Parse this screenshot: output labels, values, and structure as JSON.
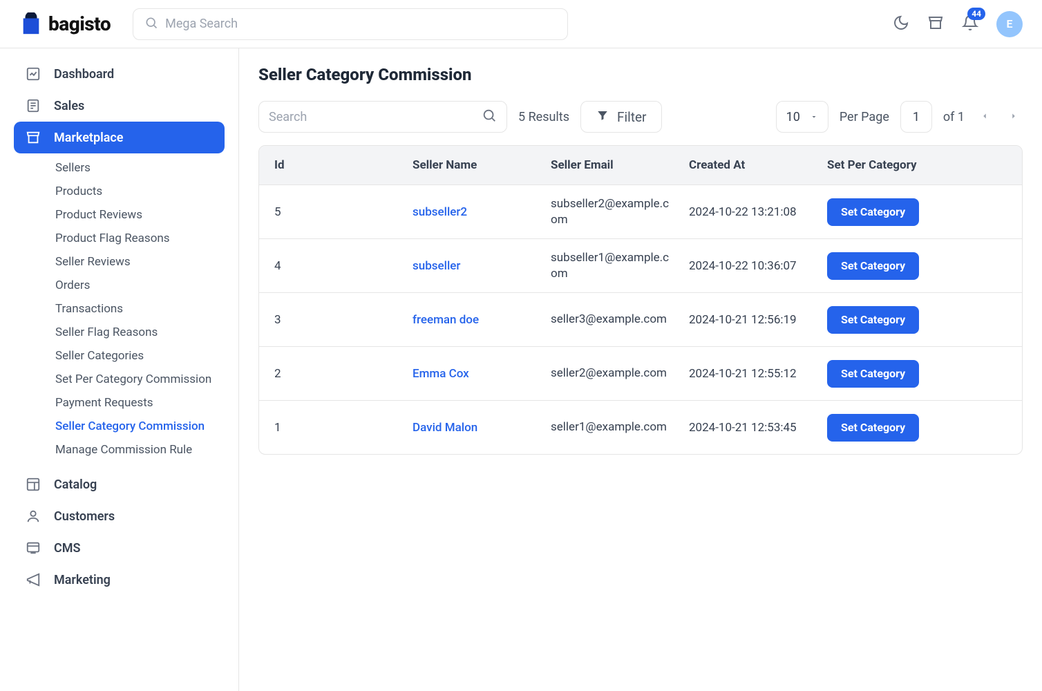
{
  "header": {
    "logo_text": "bagisto",
    "search_placeholder": "Mega Search",
    "notification_count": "44",
    "avatar_initial": "E"
  },
  "sidebar": {
    "items": [
      {
        "icon": "dashboard",
        "label": "Dashboard"
      },
      {
        "icon": "sales",
        "label": "Sales"
      },
      {
        "icon": "marketplace",
        "label": "Marketplace",
        "active": true
      },
      {
        "icon": "catalog",
        "label": "Catalog"
      },
      {
        "icon": "customers",
        "label": "Customers"
      },
      {
        "icon": "cms",
        "label": "CMS"
      },
      {
        "icon": "marketing",
        "label": "Marketing"
      }
    ],
    "marketplace_sub": [
      {
        "label": "Sellers"
      },
      {
        "label": "Products"
      },
      {
        "label": "Product Reviews"
      },
      {
        "label": "Product Flag Reasons"
      },
      {
        "label": "Seller Reviews"
      },
      {
        "label": "Orders"
      },
      {
        "label": "Transactions"
      },
      {
        "label": "Seller Flag Reasons"
      },
      {
        "label": "Seller Categories"
      },
      {
        "label": "Set Per Category Commission"
      },
      {
        "label": "Payment Requests"
      },
      {
        "label": "Seller Category Commission",
        "active": true
      },
      {
        "label": "Manage Commission Rule"
      }
    ]
  },
  "page": {
    "title": "Seller Category Commission"
  },
  "toolbar": {
    "search_placeholder": "Search",
    "results_text": "5 Results",
    "filter_label": "Filter",
    "perpage_value": "10",
    "perpage_label": "Per Page",
    "page_current": "1",
    "page_of_prefix": "of",
    "page_total": "1"
  },
  "table": {
    "headers": {
      "id": "Id",
      "seller_name": "Seller Name",
      "seller_email": "Seller Email",
      "created_at": "Created At",
      "action": "Set Per Category"
    },
    "action_label": "Set Category",
    "rows": [
      {
        "id": "5",
        "name": "subseller2",
        "email": "subseller2@example.com",
        "created": "2024-10-22 13:21:08"
      },
      {
        "id": "4",
        "name": "subseller",
        "email": "subseller1@example.com",
        "created": "2024-10-22 10:36:07"
      },
      {
        "id": "3",
        "name": "freeman doe",
        "email": "seller3@example.com",
        "created": "2024-10-21 12:56:19"
      },
      {
        "id": "2",
        "name": "Emma Cox",
        "email": "seller2@example.com",
        "created": "2024-10-21 12:55:12"
      },
      {
        "id": "1",
        "name": "David Malon",
        "email": "seller1@example.com",
        "created": "2024-10-21 12:53:45"
      }
    ]
  }
}
